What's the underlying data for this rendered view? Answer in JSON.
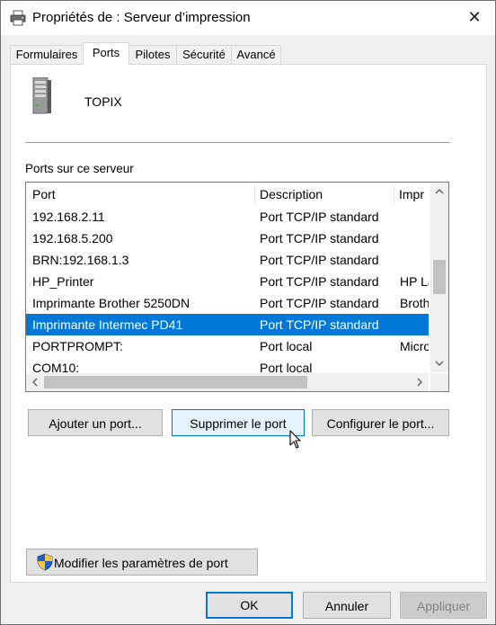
{
  "window": {
    "title": "Propriétés de : Serveur d’impression",
    "title_icon": "printer-icon",
    "close_label": "✕"
  },
  "tabs": [
    {
      "label": "Formulaires"
    },
    {
      "label": "Ports",
      "active": true
    },
    {
      "label": "Pilotes"
    },
    {
      "label": "Sécurité"
    },
    {
      "label": "Avancé"
    }
  ],
  "server": {
    "icon": "server-icon",
    "name": "TOPIX"
  },
  "ports_list": {
    "caption": "Ports sur ce serveur",
    "columns": [
      "Port",
      "Description",
      "Imprimante"
    ],
    "columns_visible_text": [
      "Port",
      "Description",
      "Impr"
    ],
    "rows": [
      {
        "port": "192.168.2.11",
        "description": "Port TCP/IP standard",
        "printer": ""
      },
      {
        "port": "192.168.5.200",
        "description": "Port TCP/IP standard",
        "printer": ""
      },
      {
        "port": "BRN:192.168.1.3",
        "description": "Port TCP/IP standard",
        "printer": ""
      },
      {
        "port": "HP_Printer",
        "description": "Port TCP/IP standard",
        "printer": "HP La"
      },
      {
        "port": "Imprimante Brother 5250DN",
        "description": "Port TCP/IP standard",
        "printer": "Broth"
      },
      {
        "port": "Imprimante Intermec PD41",
        "description": "Port TCP/IP standard",
        "printer": "",
        "selected": true
      },
      {
        "port": "PORTPROMPT:",
        "description": "Port local",
        "printer": "Micro"
      },
      {
        "port": "COM10:",
        "description": "Port local",
        "printer": ""
      }
    ]
  },
  "buttons": {
    "add_port": "Ajouter un port...",
    "delete_port": "Supprimer le port",
    "configure_port": "Configurer le port...",
    "change_port_settings": "Modifier les paramètres de port",
    "ok": "OK",
    "cancel": "Annuler",
    "apply": "Appliquer"
  },
  "colors": {
    "selection": "#0078d7",
    "accent": "#0078d7"
  }
}
